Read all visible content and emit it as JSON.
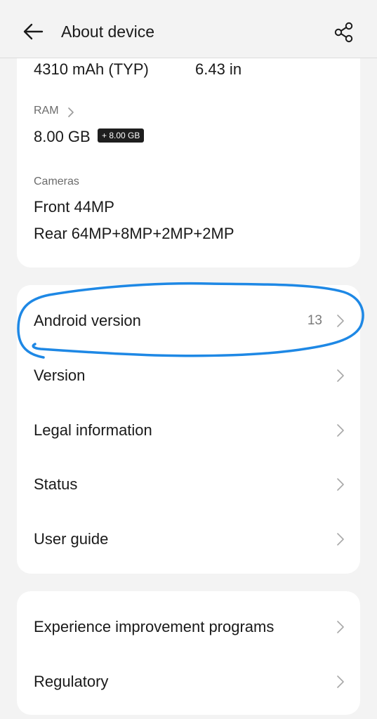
{
  "header": {
    "title": "About device",
    "back_icon": "arrow-left-icon",
    "share_icon": "share-icon"
  },
  "specs": {
    "battery": "4310 mAh (TYP)",
    "screen": "6.43 in",
    "ram_label": "RAM",
    "ram_value": "8.00 GB",
    "ram_badge": "+ 8.00 GB",
    "cameras_label": "Cameras",
    "front_camera": "Front 44MP",
    "rear_camera": "Rear 64MP+8MP+2MP+2MP"
  },
  "info_list": [
    {
      "label": "Android version",
      "value": "13"
    },
    {
      "label": "Version",
      "value": ""
    },
    {
      "label": "Legal information",
      "value": ""
    },
    {
      "label": "Status",
      "value": ""
    },
    {
      "label": "User guide",
      "value": ""
    }
  ],
  "more_list": [
    {
      "label": "Experience improvement programs"
    },
    {
      "label": "Regulatory"
    }
  ],
  "colors": {
    "background": "#f3f3f3",
    "card": "#ffffff",
    "annotation": "#1e88e5",
    "badge": "#1e1e1e"
  }
}
